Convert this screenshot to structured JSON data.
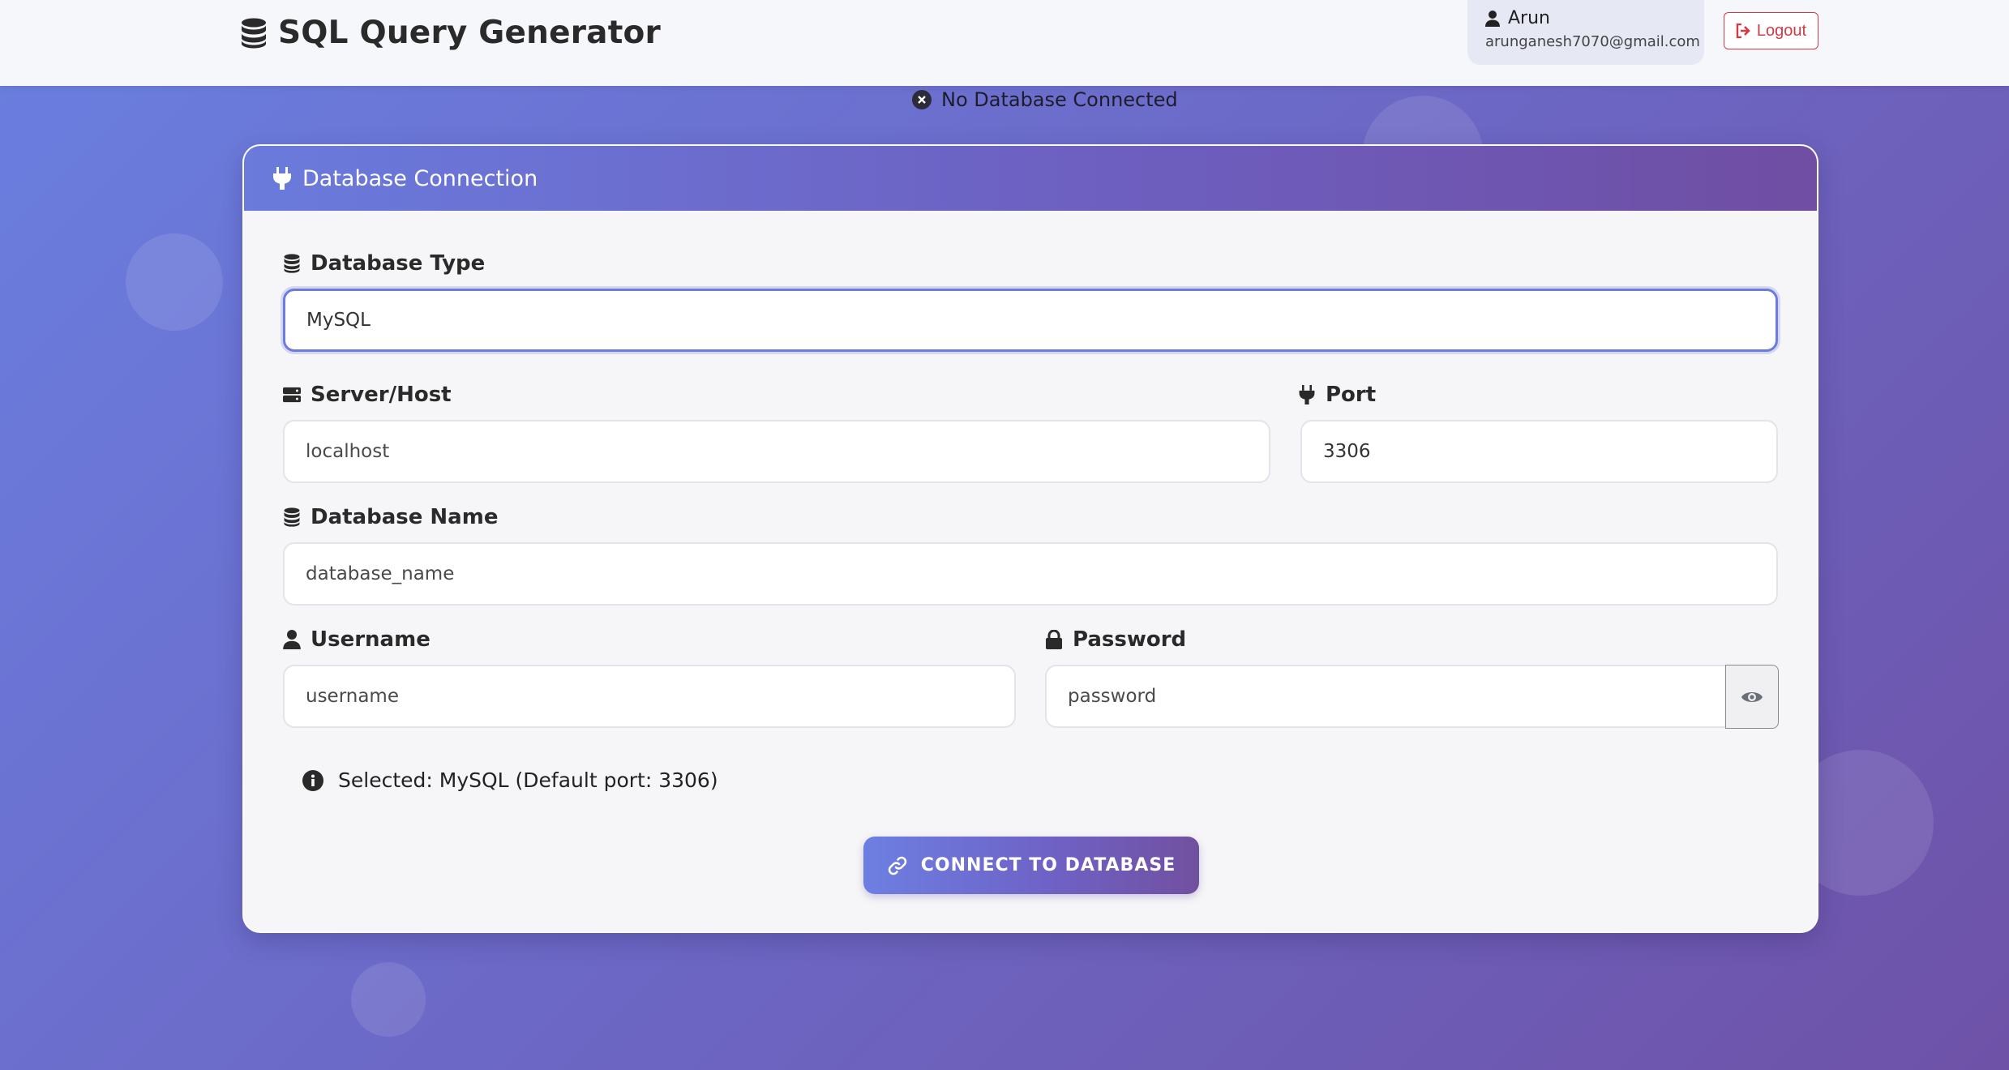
{
  "app": {
    "title": "SQL Query Generator"
  },
  "user": {
    "name": "Arun",
    "email": "arunganesh7070@gmail.com",
    "logout_label": "Logout"
  },
  "status": {
    "text": "No Database Connected"
  },
  "connection_card": {
    "title": "Database Connection",
    "db_type": {
      "label": "Database Type",
      "value": "MySQL"
    },
    "host": {
      "label": "Server/Host",
      "placeholder": "localhost"
    },
    "port": {
      "label": "Port",
      "value": "3306"
    },
    "db_name": {
      "label": "Database Name",
      "placeholder": "database_name"
    },
    "username": {
      "label": "Username",
      "placeholder": "username"
    },
    "password": {
      "label": "Password",
      "placeholder": "password"
    },
    "selected_info": "Selected: MySQL (Default port: 3306)",
    "connect_button": "CONNECT TO DATABASE"
  },
  "colors": {
    "accent": "#6c7be0",
    "logout": "#d23b46",
    "header_bg": "#f6f7fb"
  }
}
